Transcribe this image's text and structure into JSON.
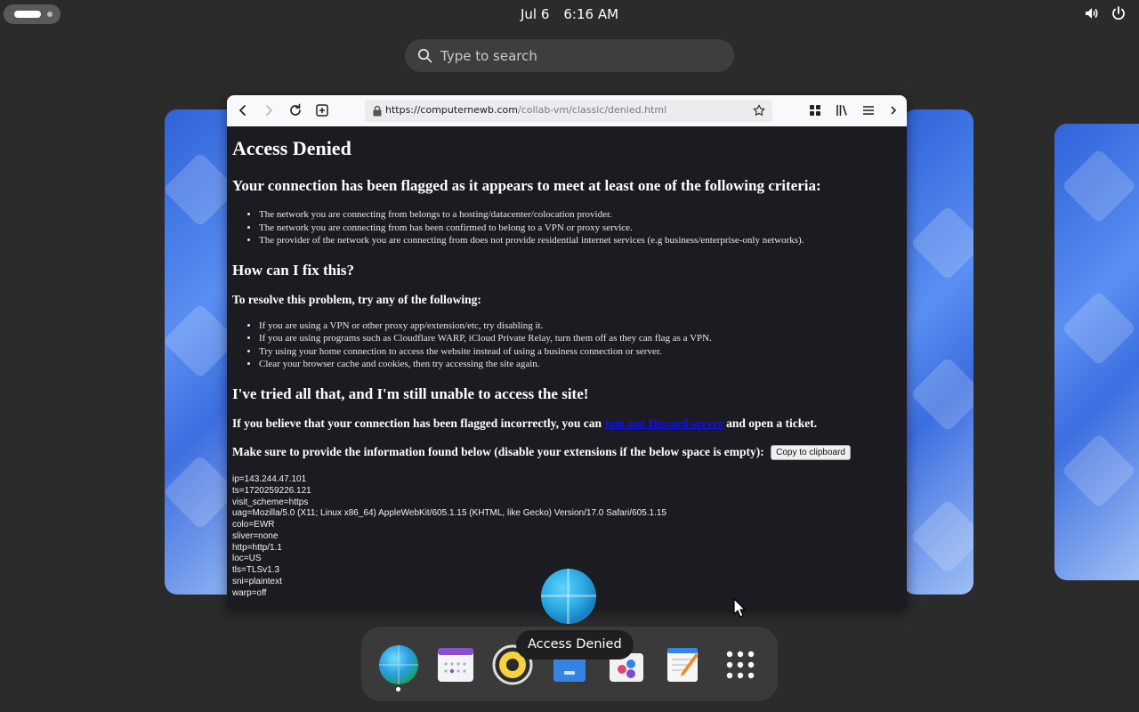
{
  "topbar": {
    "date": "Jul 6",
    "time": "6:16 AM",
    "tray_icons": [
      "volume-icon",
      "power-icon"
    ]
  },
  "search": {
    "placeholder": "Type to search"
  },
  "browser": {
    "url_host": "https://computernewb.com",
    "url_path": "/collab-vm/classic/denied.html",
    "toolbar_icons": [
      "back-icon",
      "forward-icon",
      "reload-icon",
      "new-tab-icon",
      "lock-icon",
      "bookmark-star-icon",
      "extensions-icon",
      "library-icon",
      "menu-icon"
    ]
  },
  "page": {
    "title": "Access Denied",
    "flagged_heading": "Your connection has been flagged as it appears to meet at least one of the following criteria:",
    "criteria": [
      "The network you are connecting from belongs to a hosting/datacenter/colocation provider.",
      "The network you are connecting from has been confirmed to belong to a VPN or proxy service.",
      "The provider of the network you are connecting from does not provide residential internet services (e.g business/enterprise-only networks)."
    ],
    "fix_heading": "How can I fix this?",
    "resolve_heading": "To resolve this problem, try any of the following:",
    "fixes": [
      "If you are using a VPN or other proxy app/extension/etc, try disabling it.",
      "If you are using programs such as Cloudflare WARP, iCloud Private Relay, turn them off as they can flag as a VPN.",
      "Try using your home connection to access the website instead of using a business connection or server.",
      "Clear your browser cache and cookies, then try accessing the site again."
    ],
    "tried_heading": "I've tried all that, and I'm still unable to access the site!",
    "incorrect_prefix": "If you believe that your connection has been flagged incorrectly, you can",
    "incorrect_link": "join our Discord server",
    "incorrect_suffix": "and open a ticket.",
    "provide_info": "Make sure to provide the information found below (disable your extensions if the below space is empty):",
    "copy_button": "Copy to clipboard",
    "trace": [
      "ip=143.244.47.101",
      "ts=1720259226.121",
      "visit_scheme=https",
      "uag=Mozilla/5.0 (X11; Linux x86_64) AppleWebKit/605.1.15 (KHTML, like Gecko) Version/17.0 Safari/605.1.15",
      "colo=EWR",
      "sliver=none",
      "http=http/1.1",
      "loc=US",
      "tls=TLSv1.3",
      "sni=plaintext",
      "warp=off"
    ]
  },
  "dock": {
    "tooltip": "Access Denied",
    "items": [
      "web-browser-icon",
      "calendar-icon",
      "rhythmbox-icon",
      "software-store-icon",
      "text-editor-icon",
      "show-apps-icon"
    ]
  }
}
